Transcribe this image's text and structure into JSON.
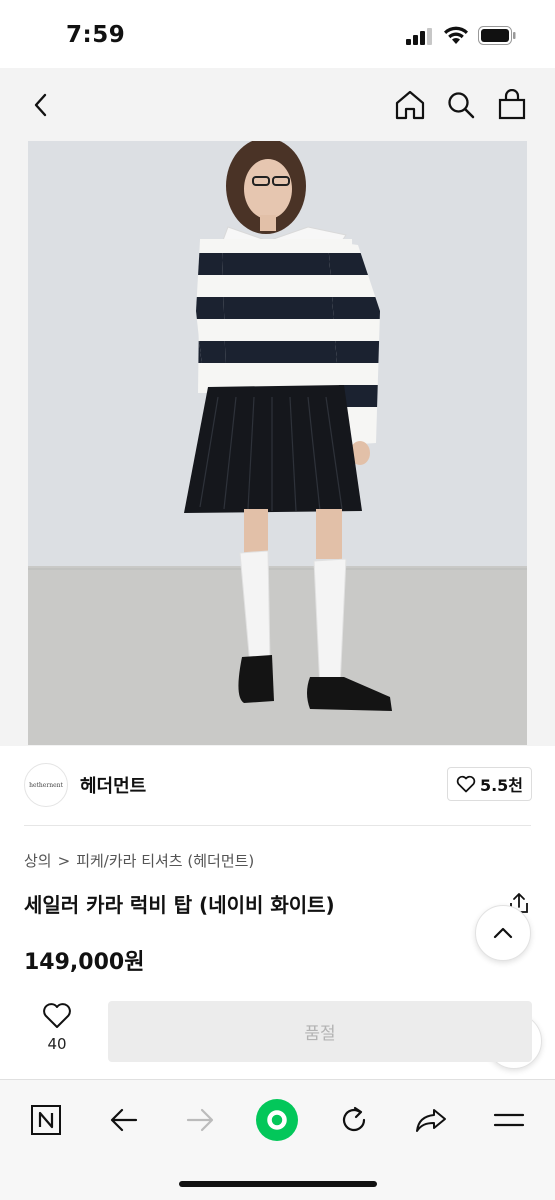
{
  "status_bar": {
    "time": "7:59"
  },
  "icons": {
    "back": "chevron-left-icon",
    "home": "home-icon",
    "search": "search-icon",
    "bag": "shopping-bag-icon",
    "heart": "heart-icon",
    "share": "share-icon",
    "scroll_up": "chevron-up-icon",
    "to_top": "arrow-up-icon"
  },
  "brand": {
    "logo_text": "hethernent",
    "name": "헤더먼트",
    "likes": "5.5천"
  },
  "breadcrumb": {
    "category": "상의",
    "separator": ">",
    "subcategory": "피케/카라 티셔츠 (헤더먼트)"
  },
  "product": {
    "title": "세일러 카라 럭비 탑 (네이비 화이트)",
    "price": "149,000원"
  },
  "actions": {
    "wish_count": "40",
    "buy_label": "품절"
  },
  "browser_toolbar": {
    "items": [
      "naver-n-icon",
      "back-arrow-icon",
      "forward-arrow-icon",
      "green-dot-icon",
      "refresh-icon",
      "share-arrow-icon",
      "menu-icon"
    ],
    "accent": "#03c75a"
  }
}
